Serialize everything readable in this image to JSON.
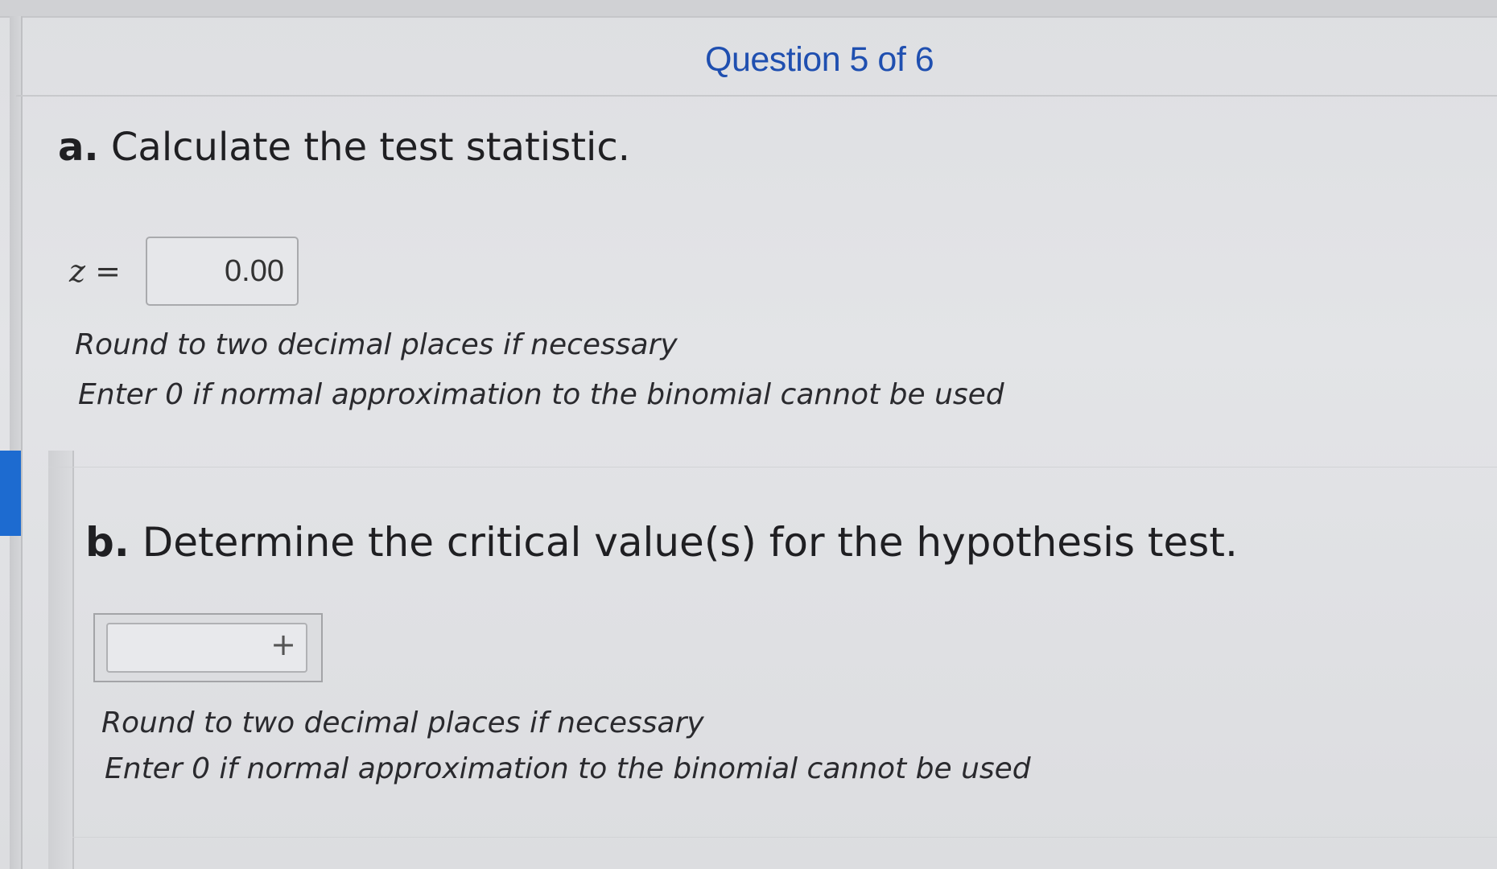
{
  "header": {
    "question_progress": "Question 5 of 6"
  },
  "part_a": {
    "letter": "a.",
    "prompt": "Calculate the test statistic.",
    "variable_label": "z =",
    "answer_value": "0.00",
    "hint_round": "Round to two decimal places if necessary",
    "hint_zero": "Enter 0 if normal approximation to the binomial cannot be used"
  },
  "part_b": {
    "letter": "b.",
    "prompt": "Determine the critical value(s) for the hypothesis test.",
    "add_value_symbol": "+",
    "hint_round": "Round to two decimal places if necessary",
    "hint_zero": "Enter 0 if normal approximation to the binomial cannot be used"
  },
  "colors": {
    "accent": "#1d6bd0",
    "title": "#1f4fb0",
    "text": "#1f1f22"
  }
}
